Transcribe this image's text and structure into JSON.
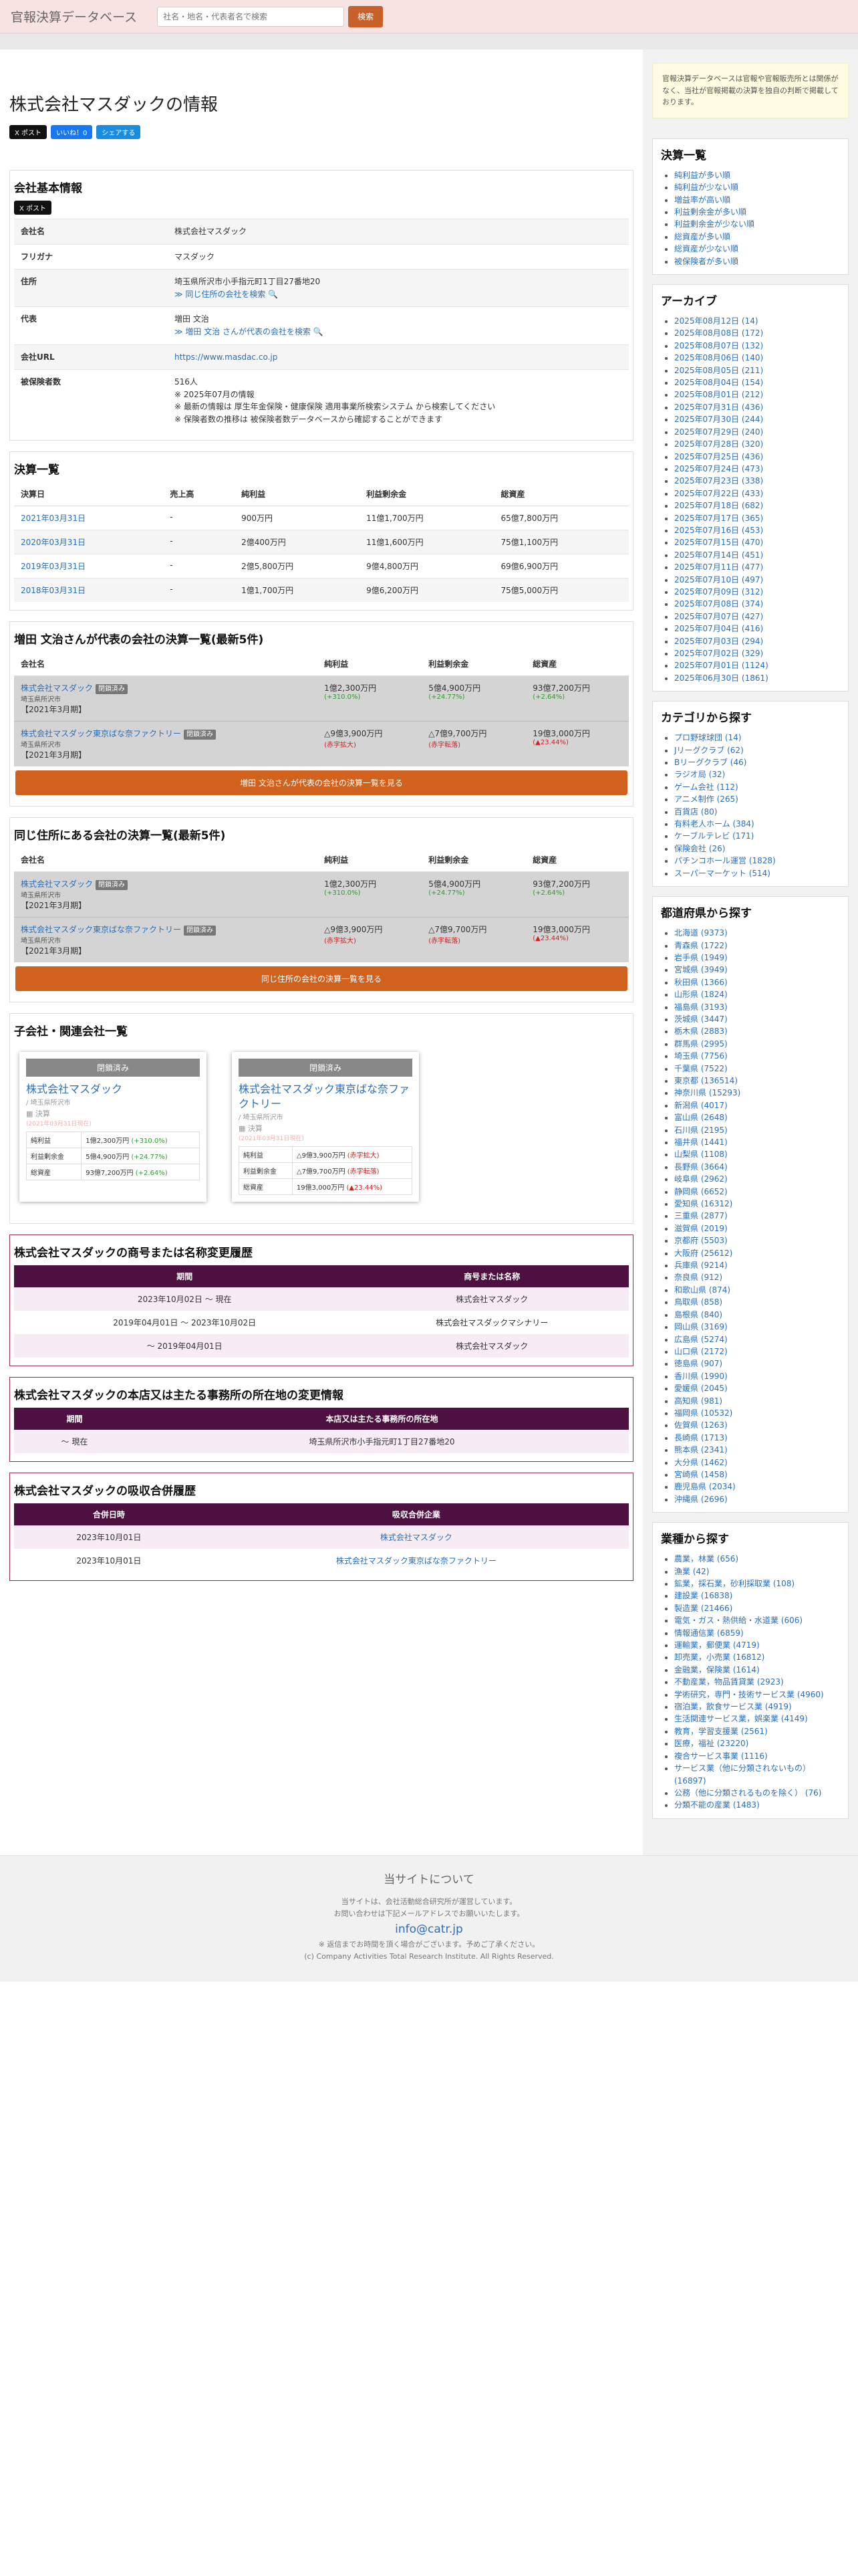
{
  "header": {
    "brand": "官報決算データベース",
    "search_placeholder": "社名・地名・代表者名で検索",
    "search_button": "検索"
  },
  "page": {
    "title": "株式会社マスダックの情報",
    "share_x": "X ポスト",
    "share_fb": "いいね！0",
    "share_sh": "シェアする"
  },
  "basic": {
    "heading": "会社基本情報",
    "x_button": "X ポスト",
    "rows": [
      {
        "k": "会社名",
        "v": [
          "株式会社マスダック"
        ]
      },
      {
        "k": "フリガナ",
        "v": [
          "マスダック"
        ]
      },
      {
        "k": "住所",
        "v": [
          "埼玉県所沢市小手指元町1丁目27番地20"
        ],
        "link": "≫ 同じ住所の会社を検索 🔍"
      },
      {
        "k": "代表",
        "v": [
          "増田 文治"
        ],
        "link": "≫ 増田 文治 さんが代表の会社を検索 🔍"
      },
      {
        "k": "会社URL",
        "v": [],
        "link": "https://www.masdac.co.jp"
      },
      {
        "k": "被保険者数",
        "v": [
          "516人",
          "※ 2025年07月の情報",
          "※ 最新の情報は 厚生年金保険・健康保険 適用事業所検索システム から検索してください",
          "※ 保険者数の推移は 被保険者数データベースから確認することができます"
        ]
      }
    ]
  },
  "kessan": {
    "heading": "決算一覧",
    "cols": [
      "決算日",
      "売上高",
      "純利益",
      "利益剰余金",
      "総資産"
    ],
    "rows": [
      [
        "2021年03月31日",
        "-",
        "900万円",
        "11億1,700万円",
        "65億7,800万円"
      ],
      [
        "2020年03月31日",
        "-",
        "2億400万円",
        "11億1,600万円",
        "75億1,100万円"
      ],
      [
        "2019年03月31日",
        "-",
        "2億5,800万円",
        "9億4,800万円",
        "69億6,900万円"
      ],
      [
        "2018年03月31日",
        "-",
        "1億1,700万円",
        "9億6,200万円",
        "75億5,000万円"
      ]
    ]
  },
  "rep": {
    "heading": "増田 文治さんが代表の会社の決算一覧(最新5件)",
    "cols": [
      "会社名",
      "純利益",
      "利益剰余金",
      "総資産"
    ],
    "rows": [
      {
        "name": "株式会社マスダック",
        "badge": "閉鎖済み",
        "addr": "埼玉県所沢市",
        "period": "【2021年3月期】",
        "c1": "1億2,300万円",
        "d1": "(+310.0%)",
        "c2": "5億4,900万円",
        "d2": "(+24.77%)",
        "c3": "93億7,200万円",
        "d3": "(+2.64%)",
        "neg": false
      },
      {
        "name": "株式会社マスダック東京ばな奈ファクトリー",
        "badge": "閉鎖済み",
        "addr": "埼玉県所沢市",
        "period": "【2021年3月期】",
        "c1": "△9億3,900万円",
        "d1": "(赤字拡大)",
        "c2": "△7億9,700万円",
        "d2": "(赤字転落)",
        "c3": "19億3,000万円",
        "d3": "(▲23.44%)",
        "neg": true
      }
    ],
    "button": "増田 文治さんが代表の会社の決算一覧を見る"
  },
  "same": {
    "heading": "同じ住所にある会社の決算一覧(最新5件)",
    "button": "同じ住所の会社の決算一覧を見る"
  },
  "sub": {
    "heading": "子会社・関連会社一覧",
    "cards": [
      {
        "badge": "閉鎖済み",
        "name": "株式会社マスダック",
        "addr": "/ 埼玉県所沢市",
        "kessan": "▦ 決算",
        "date": "(2021年03月31日現在)",
        "rows": [
          [
            "純利益",
            "1億2,300万円",
            "(+310.0%)"
          ],
          [
            "利益剰余金",
            "5億4,900万円",
            "(+24.77%)"
          ],
          [
            "総資産",
            "93億7,200万円",
            "(+2.64%)"
          ]
        ],
        "neg": false
      },
      {
        "badge": "閉鎖済み",
        "name": "株式会社マスダック東京ばな奈ファクトリー",
        "addr": "/ 埼玉県所沢市",
        "kessan": "▦ 決算",
        "date": "(2021年03月31日現在)",
        "rows": [
          [
            "純利益",
            "△9億3,900万円",
            "(赤字拡大)"
          ],
          [
            "利益剰余金",
            "△7億9,700万円",
            "(赤字転落)"
          ],
          [
            "総資産",
            "19億3,000万円",
            "(▲23.44%)"
          ]
        ],
        "neg": true
      }
    ]
  },
  "names": {
    "heading": "株式会社マスダックの商号または名称変更履歴",
    "cols": [
      "期間",
      "商号または名称"
    ],
    "rows": [
      [
        "2023年10月02日 〜 現在",
        "株式会社マスダック"
      ],
      [
        "2019年04月01日 〜 2023年10月02日",
        "株式会社マスダックマシナリー"
      ],
      [
        "〜 2019年04月01日",
        "株式会社マスダック"
      ]
    ]
  },
  "addrs": {
    "heading": "株式会社マスダックの本店又は主たる事務所の所在地の変更情報",
    "cols": [
      "期間",
      "本店又は主たる事務所の所在地"
    ],
    "rows": [
      [
        "〜 現在",
        "埼玉県所沢市小手指元町1丁目27番地20"
      ]
    ]
  },
  "merge": {
    "heading": "株式会社マスダックの吸収合併履歴",
    "cols": [
      "合併日時",
      "吸収合併企業"
    ],
    "rows": [
      [
        "2023年10月01日",
        "株式会社マスダック"
      ],
      [
        "2023年10月01日",
        "株式会社マスダック東京ばな奈ファクトリー"
      ]
    ]
  },
  "side": {
    "notice": "官報決算データベースは官報や官報販売所とは関係がなく、当社が官報掲載の決算を独自の判断で掲載しております。",
    "kessan_heading": "決算一覧",
    "kessan_items": [
      "純利益が多い順",
      "純利益が少ない順",
      "増益率が高い順",
      "利益剰余金が多い順",
      "利益剰余金が少ない順",
      "総資産が多い順",
      "総資産が少ない順",
      "被保険者が多い順"
    ],
    "archive_heading": "アーカイブ",
    "archive_items": [
      "2025年08月12日 (14)",
      "2025年08月08日 (172)",
      "2025年08月07日 (132)",
      "2025年08月06日 (140)",
      "2025年08月05日 (211)",
      "2025年08月04日 (154)",
      "2025年08月01日 (212)",
      "2025年07月31日 (436)",
      "2025年07月30日 (244)",
      "2025年07月29日 (240)",
      "2025年07月28日 (320)",
      "2025年07月25日 (436)",
      "2025年07月24日 (473)",
      "2025年07月23日 (338)",
      "2025年07月22日 (433)",
      "2025年07月18日 (682)",
      "2025年07月17日 (365)",
      "2025年07月16日 (453)",
      "2025年07月15日 (470)",
      "2025年07月14日 (451)",
      "2025年07月11日 (477)",
      "2025年07月10日 (497)",
      "2025年07月09日 (312)",
      "2025年07月08日 (374)",
      "2025年07月07日 (427)",
      "2025年07月04日 (416)",
      "2025年07月03日 (294)",
      "2025年07月02日 (329)",
      "2025年07月01日 (1124)",
      "2025年06月30日 (1861)"
    ],
    "cat_heading": "カテゴリから探す",
    "cat_items": [
      "プロ野球球団 (14)",
      "Jリーグクラブ (62)",
      "Bリーグクラブ (46)",
      "ラジオ局 (32)",
      "ゲーム会社 (112)",
      "アニメ制作 (265)",
      "百貨店 (80)",
      "有料老人ホーム (384)",
      "ケーブルテレビ (171)",
      "保険会社 (26)",
      "パチンコホール運営 (1828)",
      "スーパーマーケット (514)"
    ],
    "pref_heading": "都道府県から探す",
    "pref_items": [
      "北海道 (9373)",
      "青森県 (1722)",
      "岩手県 (1949)",
      "宮城県 (3949)",
      "秋田県 (1366)",
      "山形県 (1824)",
      "福島県 (3193)",
      "茨城県 (3447)",
      "栃木県 (2883)",
      "群馬県 (2995)",
      "埼玉県 (7756)",
      "千葉県 (7522)",
      "東京都 (136514)",
      "神奈川県 (15293)",
      "新潟県 (4017)",
      "富山県 (2648)",
      "石川県 (2195)",
      "福井県 (1441)",
      "山梨県 (1108)",
      "長野県 (3664)",
      "岐阜県 (2962)",
      "静岡県 (6652)",
      "愛知県 (16312)",
      "三重県 (2877)",
      "滋賀県 (2019)",
      "京都府 (5503)",
      "大阪府 (25612)",
      "兵庫県 (9214)",
      "奈良県 (912)",
      "和歌山県 (874)",
      "鳥取県 (858)",
      "島根県 (840)",
      "岡山県 (3169)",
      "広島県 (5274)",
      "山口県 (2172)",
      "徳島県 (907)",
      "香川県 (1990)",
      "愛媛県 (2045)",
      "高知県 (981)",
      "福岡県 (10532)",
      "佐賀県 (1263)",
      "長崎県 (1713)",
      "熊本県 (2341)",
      "大分県 (1462)",
      "宮崎県 (1458)",
      "鹿児島県 (2034)",
      "沖縄県 (2696)"
    ],
    "ind_heading": "業種から探す",
    "ind_items": [
      "農業，林業 (656)",
      "漁業 (42)",
      "鉱業，採石業，砂利採取業 (108)",
      "建設業 (16838)",
      "製造業 (21466)",
      "電気・ガス・熱供給・水道業 (606)",
      "情報通信業 (6859)",
      "運輸業，郵便業 (4719)",
      "卸売業，小売業 (16812)",
      "金融業，保険業 (1614)",
      "不動産業，物品賃貸業 (2923)",
      "学術研究，専門・技術サービス業 (4960)",
      "宿泊業，飲食サービス業 (4919)",
      "生活関連サービス業，娯楽業 (4149)",
      "教育，学習支援業 (2561)",
      "医療，福祉 (23220)",
      "複合サービス事業 (1116)",
      "サービス業（他に分類されないもの） (16897)",
      "公務（他に分類されるものを除く） (76)",
      "分類不能の産業 (1483)"
    ]
  },
  "footer": {
    "title": "当サイトについて",
    "line1": "当サイトは、会社活動総合研究所が運営しています。",
    "line2": "お問い合わせは下記メールアドレスでお願いいたします。",
    "mail": "info@catr.jp",
    "note": "※ 返信までお時間を頂く場合がございます。予めご了承ください。",
    "copy": "(c) Company Activities Total Research Institute. All Rights Reserved."
  }
}
